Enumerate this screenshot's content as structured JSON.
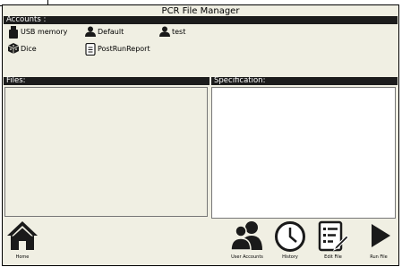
{
  "window": {
    "title": "PCR File Manager"
  },
  "accounts": {
    "header": "Accounts :",
    "items": [
      {
        "label": "USB memory",
        "icon": "usb-memory-icon"
      },
      {
        "label": "Default",
        "icon": "user-icon"
      },
      {
        "label": "test",
        "icon": "user-icon"
      },
      {
        "label": "Dice",
        "icon": "dice-icon"
      },
      {
        "label": "PostRunReport",
        "icon": "document-icon"
      }
    ]
  },
  "files": {
    "header": "Files:"
  },
  "specification": {
    "header": "Specification:"
  },
  "toolbar": {
    "home": "Home",
    "user_accounts": "User Accounts",
    "history": "History",
    "edit_file": "Edit File",
    "run_file": "Run File"
  },
  "colors": {
    "window_bg": "#f0efe3",
    "header_bar": "#1c1c1c",
    "icon": "#1a1a1a"
  }
}
